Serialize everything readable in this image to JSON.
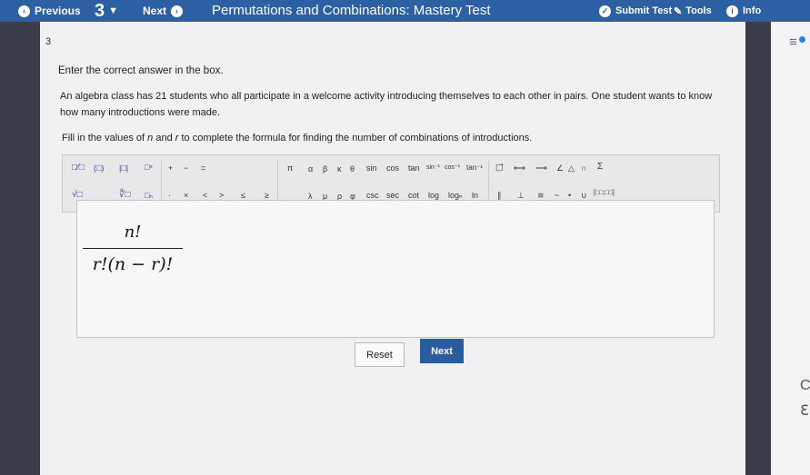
{
  "topbar": {
    "previous_label": "Previous",
    "question_number": "3",
    "next_label": "Next",
    "title": "Permutations and Combinations: Mastery Test",
    "submit_label": "Submit Test",
    "tools_label": "Tools",
    "info_label": "Info"
  },
  "question": {
    "number": "3",
    "prompt": "Enter the correct answer in the box.",
    "paragraph": "An algebra class has 21 students who all participate in a welcome activity introducing themselves to each other in pairs. One student wants to know how many introductions were made.",
    "fill_prefix": "Fill in the values of ",
    "fill_n": "n",
    "fill_and": " and ",
    "fill_r": "r",
    "fill_suffix": " to complete the formula for finding the number of combinations of introductions."
  },
  "toolbar": {
    "frac": "□⁄□",
    "paren": "(□)",
    "abs": "|□|",
    "power": "□ⁿ",
    "plus": "+",
    "minus": "−",
    "equals": "=",
    "sqrt": "√□",
    "nthroot": "∜□",
    "subscript": "□ₙ",
    "dot": "·",
    "times": "×",
    "lt": "<",
    "gt": ">",
    "le": "≤",
    "ge": "≥",
    "pi": "π",
    "alpha": "α",
    "beta": "β",
    "kappa": "κ",
    "theta": "θ",
    "lambda": "λ",
    "mu": "μ",
    "rho": "ρ",
    "phi": "φ",
    "sin": "sin",
    "cos": "cos",
    "tan": "tan",
    "asin": "sin⁻¹",
    "acos": "cos⁻¹",
    "atan": "tan⁻¹",
    "csc": "csc",
    "sec": "sec",
    "cot": "cot",
    "log": "log",
    "logn": "logₙ",
    "ln": "ln",
    "vec": "□⃗",
    "parallel": "∥",
    "line": "⟷",
    "perp": "⊥",
    "ray": "⟶",
    "approx": "≅",
    "angle": "∠",
    "triangle": "△",
    "intersection": "∩",
    "similar": "~",
    "bullet": "•",
    "union": "∪",
    "sum": "Σ",
    "matrix": "[□□;□□]"
  },
  "answer": {
    "numerator": "n!",
    "denominator": "r!(n − r)!"
  },
  "buttons": {
    "reset": "Reset",
    "next": "Next"
  },
  "colors": {
    "topbar": "#2d5fa3",
    "next_button": "#2b5c9e",
    "background": "#3a3d47",
    "content": "#f1f1f3"
  }
}
